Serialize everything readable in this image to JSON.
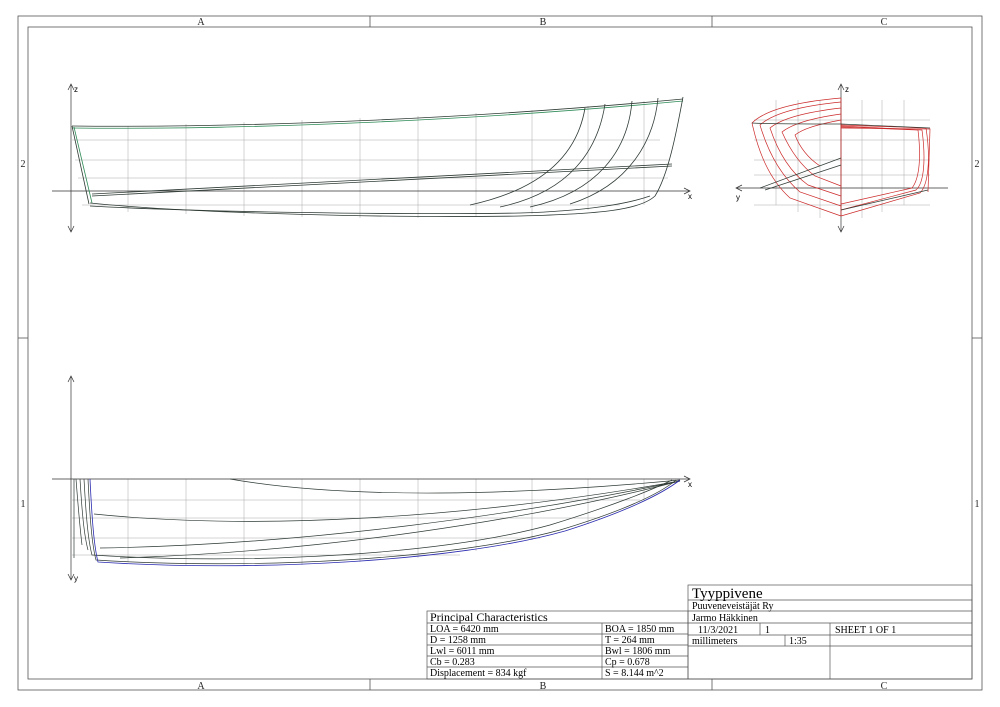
{
  "sheet": {
    "zones_top": [
      "A",
      "B",
      "C"
    ],
    "zones_bottom": [
      "A",
      "B",
      "C"
    ],
    "zones_side": [
      "2",
      "1"
    ]
  },
  "views": {
    "profile": {
      "axis_x": "x",
      "axis_z": "z"
    },
    "body_plan": {
      "axis_y": "y",
      "axis_z": "z"
    },
    "plan": {
      "axis_x": "x",
      "axis_y": "y"
    }
  },
  "colors": {
    "frame": "#555555",
    "grid": "#a8a8a8",
    "profile_lines": "#2f3b34",
    "sheer_green": "#2e8b57",
    "body_plan_red": "#cc2a2a",
    "plan_blue": "#2a2ab0"
  },
  "principal_characteristics": {
    "title": "Principal Characteristics",
    "rows": [
      [
        "LOA = 6420 mm",
        "BOA = 1850 mm"
      ],
      [
        "D = 1258 mm",
        "T = 264 mm"
      ],
      [
        "Lwl = 6011 mm",
        "Bwl = 1806 mm"
      ],
      [
        "Cb = 0.283",
        "Cp = 0.678"
      ],
      [
        "Displacement = 834 kgf",
        "S = 8.144 m^2"
      ]
    ]
  },
  "title_block": {
    "title": "Tyyppivene",
    "company": "Puuveneveistäjät Ry",
    "author": "Jarmo Häkkinen",
    "date": "11/3/2021",
    "revision": "1",
    "sheet": "SHEET 1 OF 1",
    "units": "millimeters",
    "scale": "1:35"
  }
}
